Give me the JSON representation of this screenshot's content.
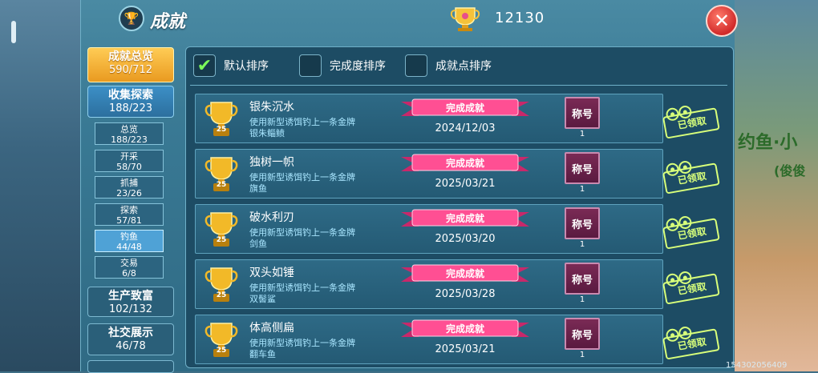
{
  "header": {
    "title": "成就",
    "points": "12130"
  },
  "sidebar": {
    "total": {
      "label": "成就总览",
      "count": "590/712"
    },
    "collect": {
      "label": "收集探索",
      "count": "188/223"
    },
    "subs": [
      {
        "label": "总览",
        "count": "188/223"
      },
      {
        "label": "开采",
        "count": "58/70"
      },
      {
        "label": "抓捕",
        "count": "23/26"
      },
      {
        "label": "探索",
        "count": "57/81"
      },
      {
        "label": "钓鱼",
        "count": "44/48"
      },
      {
        "label": "交易",
        "count": "6/8"
      }
    ],
    "production": {
      "label": "生产致富",
      "count": "102/132"
    },
    "social": {
      "label": "社交展示",
      "count": "46/78"
    }
  },
  "sort": {
    "default": "默认排序",
    "completion": "完成度排序",
    "points": "成就点排序"
  },
  "rows": [
    {
      "title": "银朱沉水",
      "desc": "使用新型诱饵钓上一条金牌",
      "fish": "银朱鲻鲼",
      "cup_points": "25",
      "badge": "完成成就",
      "date": "2024/12/03",
      "reward": "称号",
      "reward_count": "1",
      "claimed": "已领取"
    },
    {
      "title": "独树一帜",
      "desc": "使用新型诱饵钓上一条金牌",
      "fish": "旗鱼",
      "cup_points": "25",
      "badge": "完成成就",
      "date": "2025/03/21",
      "reward": "称号",
      "reward_count": "1",
      "claimed": "已领取"
    },
    {
      "title": "破水利刃",
      "desc": "使用新型诱饵钓上一条金牌",
      "fish": "剑鱼",
      "cup_points": "25",
      "badge": "完成成就",
      "date": "2025/03/20",
      "reward": "称号",
      "reward_count": "1",
      "claimed": "已领取"
    },
    {
      "title": "双头如锤",
      "desc": "使用新型诱饵钓上一条金牌",
      "fish": "双髻鲨",
      "cup_points": "25",
      "badge": "完成成就",
      "date": "2025/03/28",
      "reward": "称号",
      "reward_count": "1",
      "claimed": "已领取"
    },
    {
      "title": "体高侧扁",
      "desc": "使用新型诱饵钓上一条金牌",
      "fish": "翻车鱼",
      "cup_points": "25",
      "badge": "完成成就",
      "date": "2025/03/21",
      "reward": "称号",
      "reward_count": "1",
      "claimed": "已领取"
    }
  ],
  "background": {
    "text1": "约鱼·小",
    "text2": "(俊俊"
  },
  "footer": {
    "id": "154302056409"
  }
}
